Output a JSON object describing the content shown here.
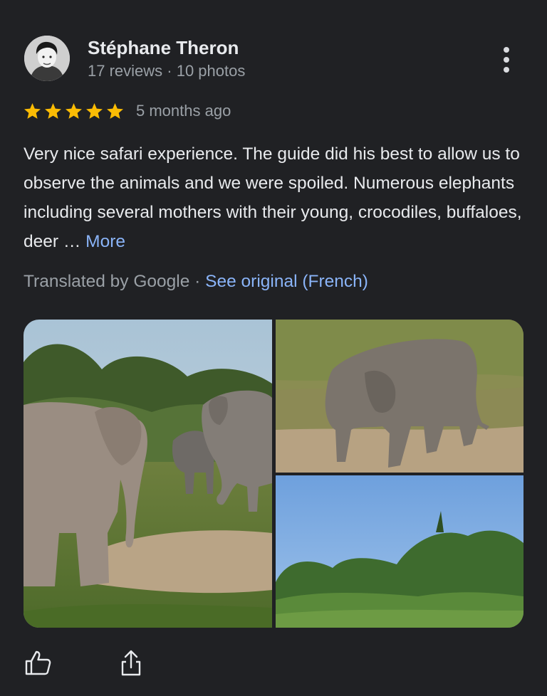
{
  "review": {
    "author": {
      "name": "Stéphane Theron",
      "meta": "17 reviews · 10 photos"
    },
    "rating": 5,
    "date": "5 months ago",
    "text": "Very nice safari experience. The guide did his best to allow us to observe the animals and we were spoiled. Numerous elephants including several mothers with their young, crocodiles, buffaloes, deer …",
    "more_label": "More",
    "translated_by": "Translated by Google",
    "separator": "·",
    "see_original_label": "See original (French)"
  },
  "icons": {
    "menu": "more-vert-icon",
    "star": "star-icon",
    "like": "thumb-up-icon",
    "share": "share-icon"
  },
  "colors": {
    "background": "#202124",
    "star": "#fbbc04",
    "link": "#8ab4f8",
    "secondary_text": "#9aa0a6"
  }
}
